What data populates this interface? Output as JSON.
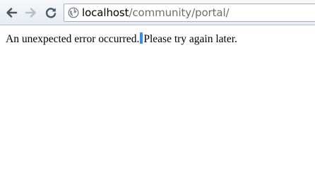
{
  "browser": {
    "url_host": "localhost",
    "url_path": "/community/portal/",
    "icons": {
      "back": "back-arrow-icon",
      "forward": "forward-arrow-icon",
      "reload": "reload-icon",
      "page": "globe-icon"
    }
  },
  "page": {
    "message_part1": "An unexpected error occurred.",
    "message_part2": "Please try again later."
  }
}
